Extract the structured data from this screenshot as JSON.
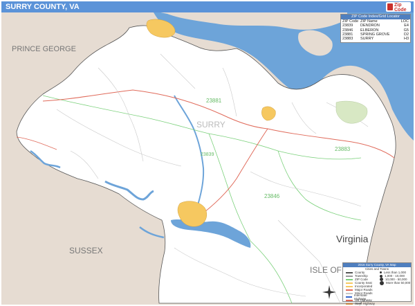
{
  "header": {
    "title": "SURRY COUNTY, VA",
    "logo_text": "Zip Code Maps"
  },
  "map_labels": {
    "prince_george": "PRINCE GEORGE",
    "sussex": "SUSSEX",
    "isle_of": "ISLE OF",
    "virginia": "Virginia",
    "surry": "SURRY",
    "zip_23881": "23881",
    "zip_23839": "23839",
    "zip_23883": "23883",
    "zip_23846": "23846"
  },
  "zip_table": {
    "title": "ZIP Code Index/Grid Locator",
    "columns": [
      "ZIP Code",
      "ZIP Name",
      "LOC"
    ],
    "rows": [
      {
        "zip": "23839",
        "name": "DENDRON",
        "loc": "E4"
      },
      {
        "zip": "23846",
        "name": "ELBERON",
        "loc": "G5"
      },
      {
        "zip": "23881",
        "name": "SPRING GROVE",
        "loc": "D2"
      },
      {
        "zip": "23883",
        "name": "SURRY",
        "loc": "H3"
      }
    ]
  },
  "legend": {
    "title": "2016 Surry County, VA Map",
    "subtitle": "Cities and Towns",
    "left_items": [
      "County",
      "Township",
      "ZIP Code",
      "County Seat",
      "Incorporated",
      "Major Roads",
      "Minor Roads",
      "Interstate Highway",
      "US Highway",
      "State Highway",
      "Railroad"
    ],
    "right_items": [
      "Less than 1,000",
      "1,000 - 10,000",
      "10,000 - 50,000",
      "More than 50,000"
    ]
  },
  "colors": {
    "water": "#6da4d9",
    "land": "#ffffff",
    "outside": "#e6dcd2",
    "town": "#f6c860",
    "park": "#d8e8c4",
    "header": "#5b93d8",
    "roads_major": "#e06a5a",
    "roads_minor": "#bbbbbb",
    "zip_boundary": "#66cc66"
  }
}
